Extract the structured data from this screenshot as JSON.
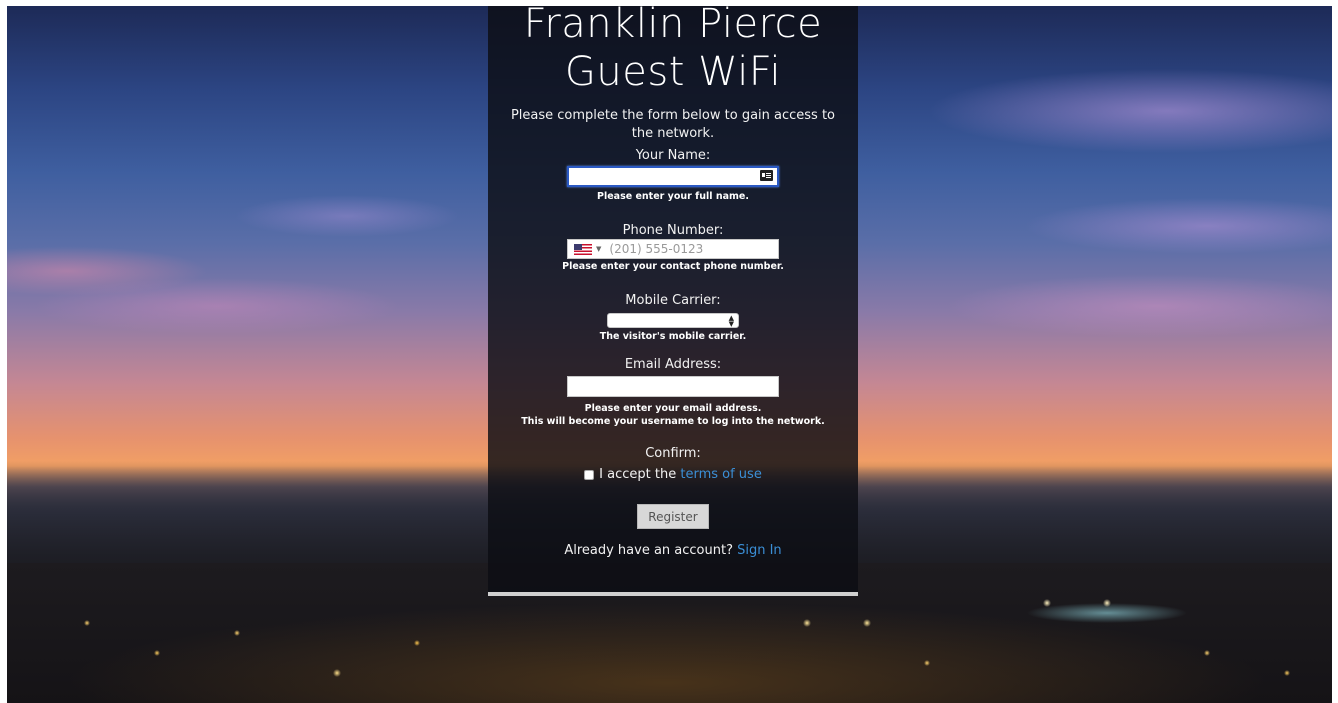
{
  "header": {
    "title_line1": "Franklin Pierce",
    "title_line2": "Guest WiFi",
    "intro": "Please complete the form below to gain access to the network."
  },
  "form": {
    "name": {
      "label": "Your Name:",
      "value": "",
      "help": "Please enter your full name.",
      "icon": "contact-card-icon"
    },
    "phone": {
      "label": "Phone Number:",
      "country": "us-flag-icon",
      "placeholder": "(201) 555-0123",
      "help": "Please enter your contact phone number."
    },
    "carrier": {
      "label": "Mobile Carrier:",
      "selected": "",
      "help": "The visitor's mobile carrier."
    },
    "email": {
      "label": "Email Address:",
      "value": "",
      "help_line1": "Please enter your email address.",
      "help_line2": "This will become your username to log into the network."
    },
    "confirm": {
      "label": "Confirm:",
      "checkbox_text": "I accept the ",
      "terms_link": "terms of use",
      "checked": false
    },
    "register_label": "Register"
  },
  "footer": {
    "already_text": "Already have an account? ",
    "sign_in_link": "Sign In"
  },
  "colors": {
    "link": "#3b8fd6",
    "focus": "#2b59c3",
    "panel": "#0c0e14"
  }
}
